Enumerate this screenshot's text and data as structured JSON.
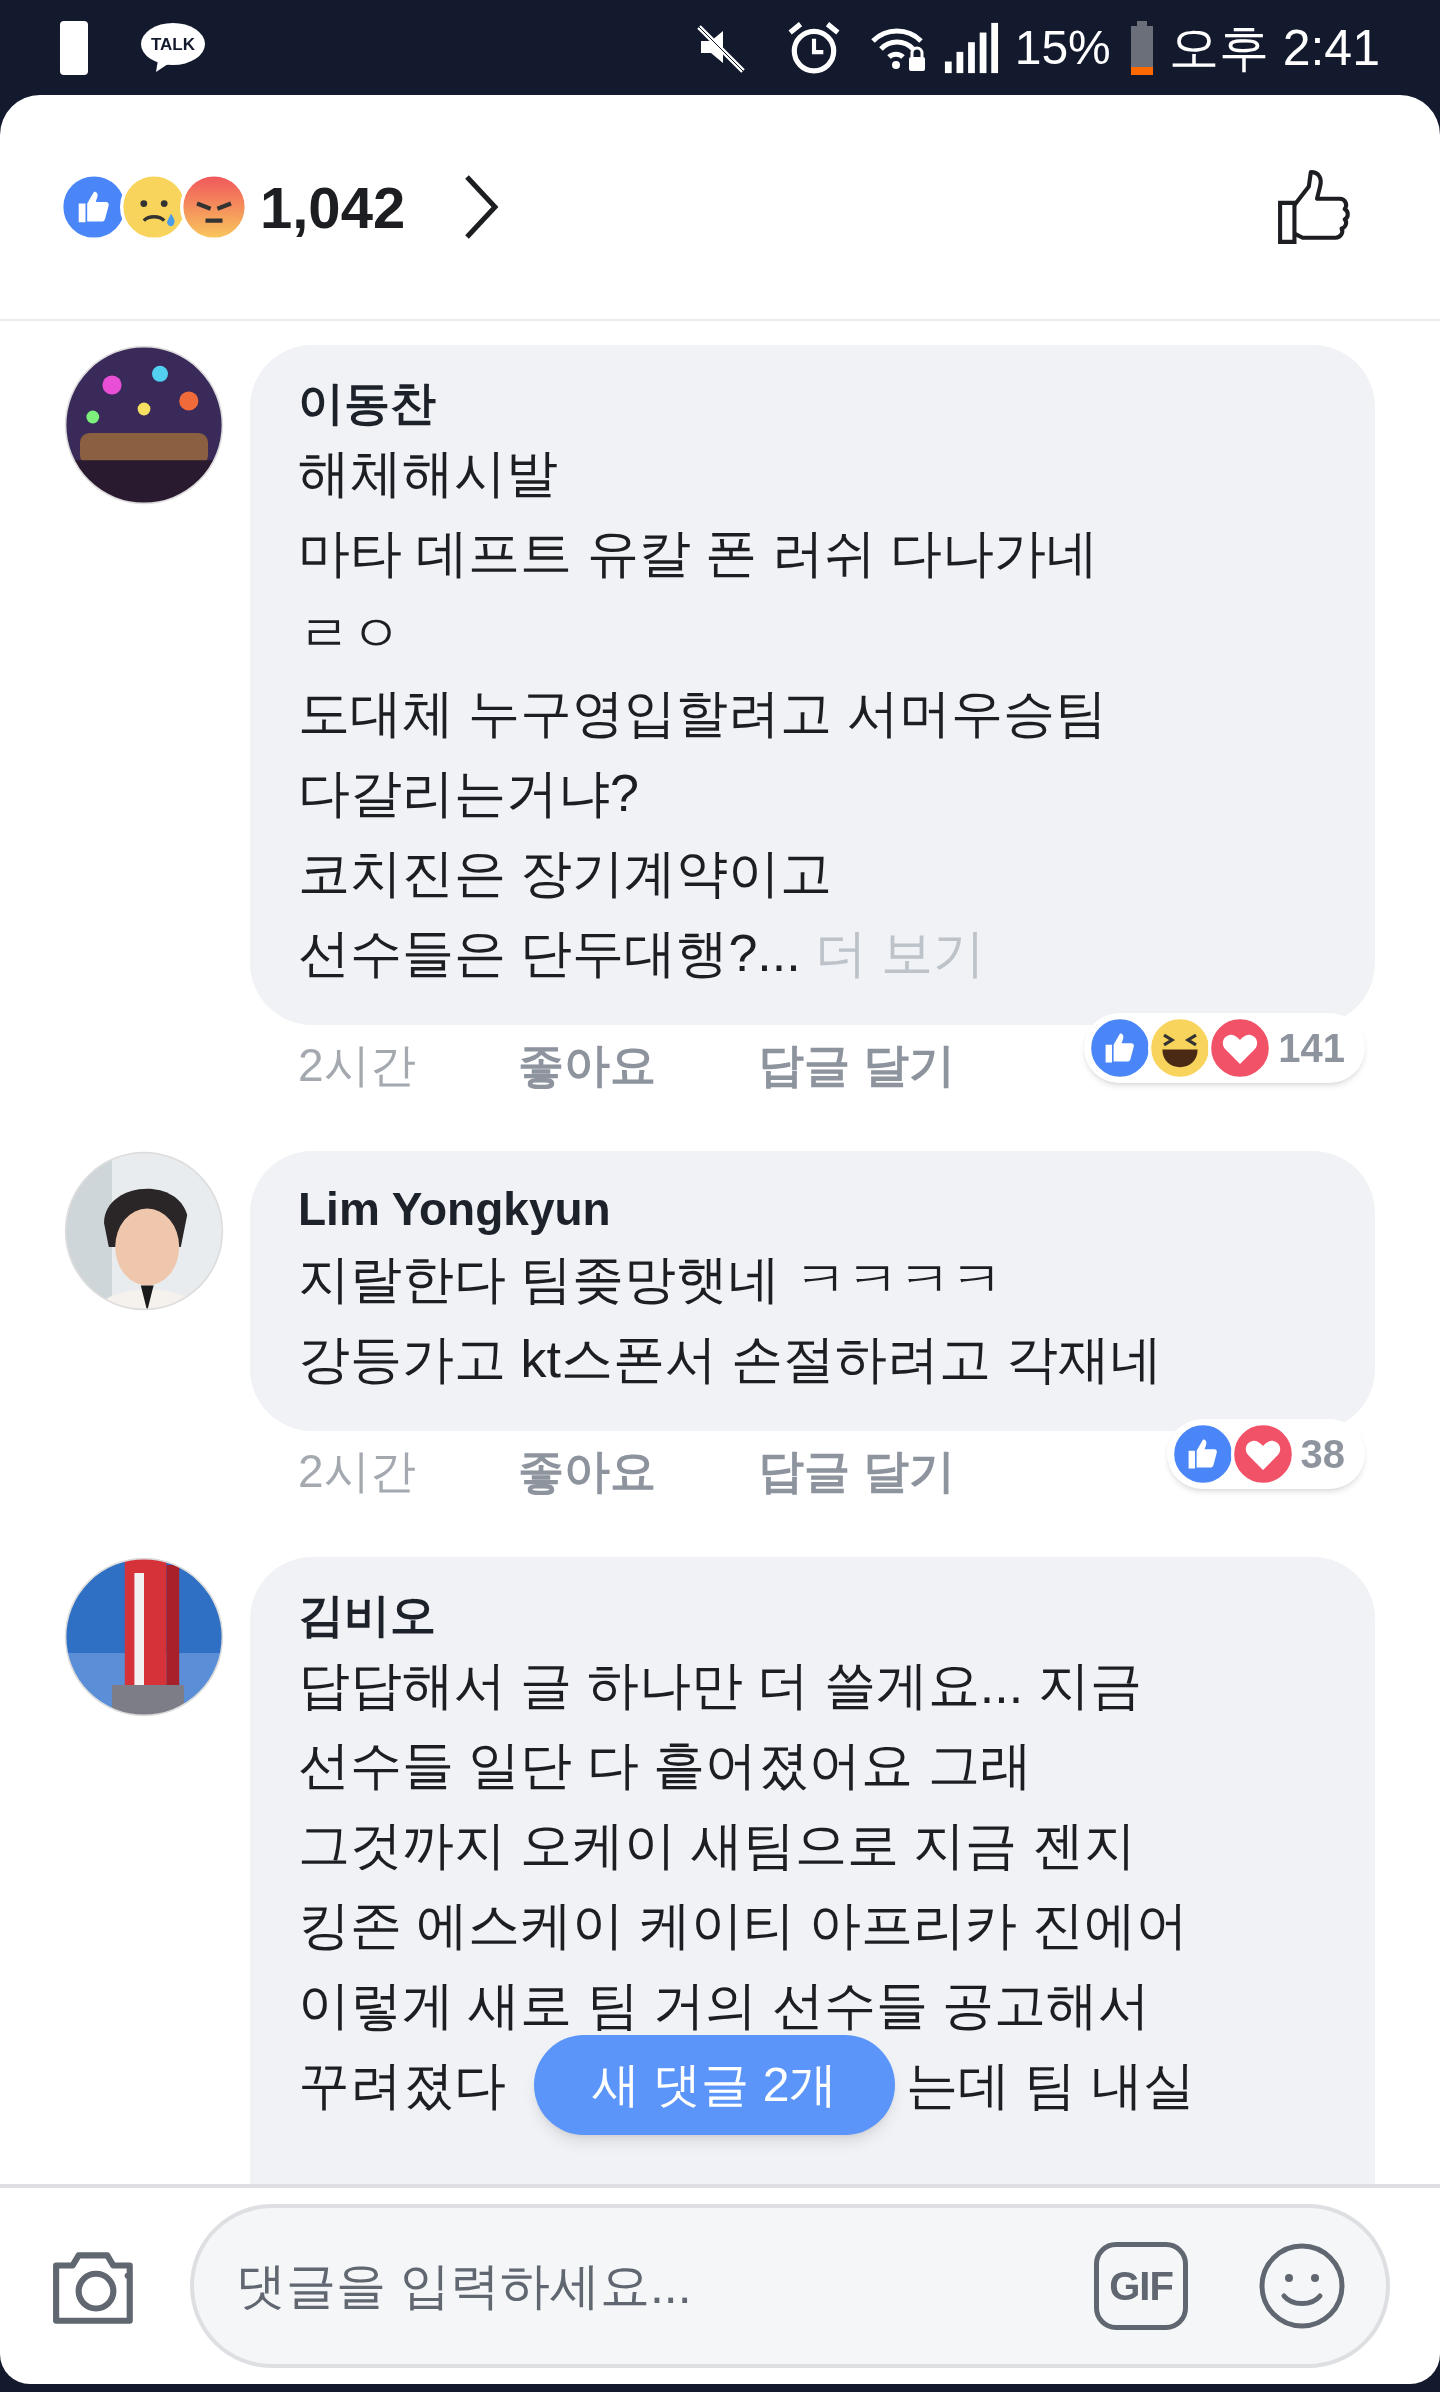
{
  "status_bar": {
    "battery": "15%",
    "time": "오후 2:41",
    "talk_badge": "TALK"
  },
  "reactions_summary": {
    "reactions": [
      {
        "kind": "like"
      },
      {
        "kind": "sad"
      },
      {
        "kind": "angry"
      }
    ],
    "count": "1,042"
  },
  "comments": [
    {
      "avatar": {
        "kind": "picture"
      },
      "author": "이동찬",
      "lines": [
        "해체해시발",
        "마타 데프트 유칼 폰 러쉬 다나가네",
        "ㄹㅇ",
        "도대체 누구영입할려고 서머우승팀",
        "다갈리는거냐?",
        "코치진은 장기계약이고",
        "선수들은 단두대행?..."
      ],
      "more": "더 보기",
      "time": "2시간",
      "like": "좋아요",
      "reply": "답글 달기",
      "reactions": [
        {
          "kind": "like"
        },
        {
          "kind": "haha"
        },
        {
          "kind": "love"
        }
      ],
      "reaction_count": "141"
    },
    {
      "avatar": {
        "kind": "picture"
      },
      "author": "Lim Yongkyun",
      "lines": [
        "지랄한다 팀좆망햇네 ㅋㅋㅋㅋ",
        "강등가고 kt스폰서 손절하려고 각재네"
      ],
      "time": "2시간",
      "like": "좋아요",
      "reply": "답글 달기",
      "reactions": [
        {
          "kind": "like"
        },
        {
          "kind": "love"
        }
      ],
      "reaction_count": "38"
    },
    {
      "avatar": {
        "kind": "picture"
      },
      "author": "김비오",
      "lines": [
        "답답해서 글 하나만 더 쓸게요... 지금",
        "선수들 일단 다 흩어졌어요 그래",
        "그것까지 오케이 새팀으로 지금 젠지",
        "킹존 에스케이 케이티 아프리카 진에어",
        "이렇게 새로 팀 거의 선수들 공고해서"
      ],
      "covered_line": [
        "꾸려졌다",
        "는데 팀 내실"
      ]
    }
  ],
  "new_comments_pill": "새 댓글 2개",
  "composer": {
    "placeholder": "댓글을 입력하세요...",
    "gif": "GIF"
  }
}
